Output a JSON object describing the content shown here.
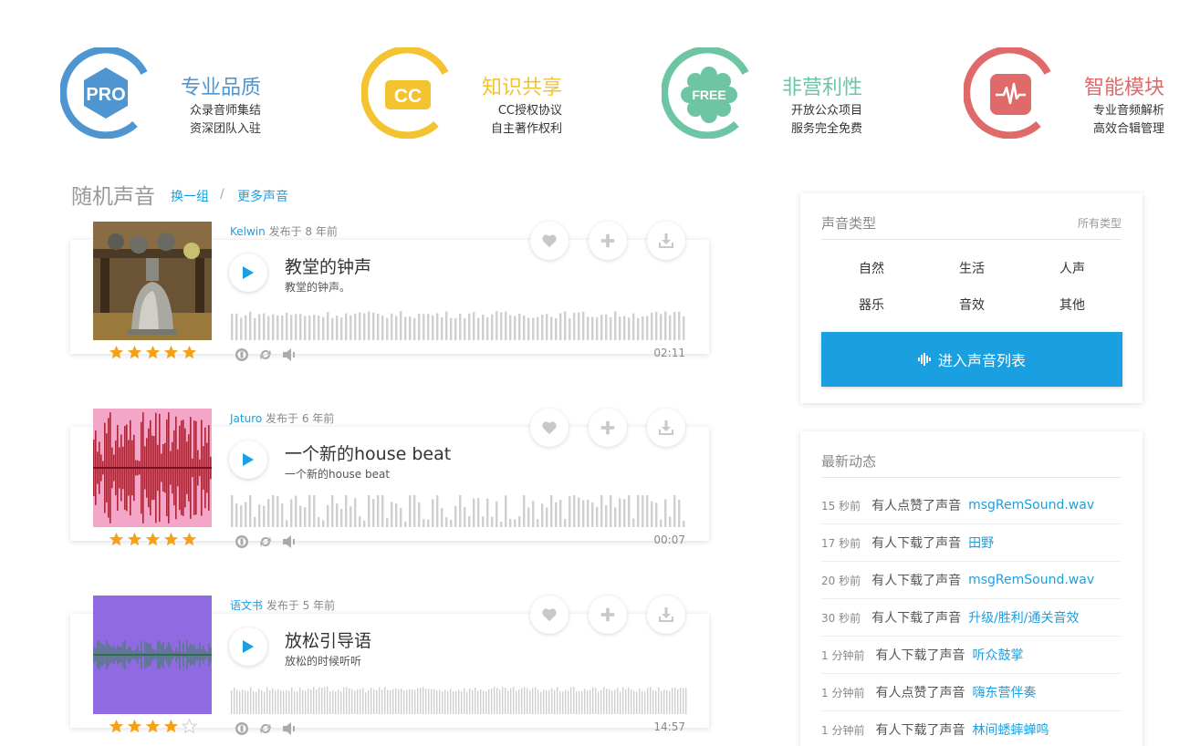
{
  "colors": {
    "accent": "#1a9fe0",
    "pro": "#4f95cf",
    "cc": "#f3c331",
    "free": "#6dc5a4",
    "smart": "#e06a6a",
    "star": "#f4a11a"
  },
  "features": [
    {
      "badge": "PRO",
      "title": "专业品质",
      "line1": "众录音师集结",
      "line2": "资深团队入驻"
    },
    {
      "badge": "CC",
      "title": "知识共享",
      "line1": "CC授权协议",
      "line2": "自主著作权利"
    },
    {
      "badge": "FREE",
      "title": "非营利性",
      "line1": "开放公众项目",
      "line2": "服务完全免费"
    },
    {
      "badge": "pulse-icon",
      "title": "智能模块",
      "line1": "专业音频解析",
      "line2": "高效合辑管理"
    }
  ],
  "section": {
    "title": "随机声音",
    "refresh": "换一组",
    "separator": "/",
    "more": "更多声音"
  },
  "sounds": [
    {
      "author": "Kelwin",
      "posted": "发布于 8 年前",
      "title": "教堂的钟声",
      "desc": "教堂的钟声。",
      "duration": "02:11",
      "rating": 5
    },
    {
      "author": "Jaturo",
      "posted": "发布于 6 年前",
      "title": "一个新的house beat",
      "desc": "一个新的house beat",
      "duration": "00:07",
      "rating": 5
    },
    {
      "author": "语文书",
      "posted": "发布于 5 年前",
      "title": "放松引导语",
      "desc": "放松的时候听听",
      "duration": "14:57",
      "rating": 4
    }
  ],
  "types_panel": {
    "title": "声音类型",
    "all": "所有类型",
    "categories": [
      "自然",
      "生活",
      "人声",
      "器乐",
      "音效",
      "其他"
    ],
    "button": "进入声音列表"
  },
  "news_panel": {
    "title": "最新动态",
    "items": [
      {
        "time": "15 秒前",
        "action": "有人点赞了声音",
        "target": "msgRemSound.wav"
      },
      {
        "time": "17 秒前",
        "action": "有人下载了声音",
        "target": "田野"
      },
      {
        "time": "20 秒前",
        "action": "有人下载了声音",
        "target": "msgRemSound.wav"
      },
      {
        "time": "30 秒前",
        "action": "有人下载了声音",
        "target": "升级/胜利/通关音效"
      },
      {
        "time": "1 分钟前",
        "action": "有人下载了声音",
        "target": "听众鼓掌"
      },
      {
        "time": "1 分钟前",
        "action": "有人点赞了声音",
        "target": "嗨东营伴奏"
      },
      {
        "time": "1 分钟前",
        "action": "有人下载了声音",
        "target": "林间蟋蟀蝉鸣"
      }
    ]
  }
}
